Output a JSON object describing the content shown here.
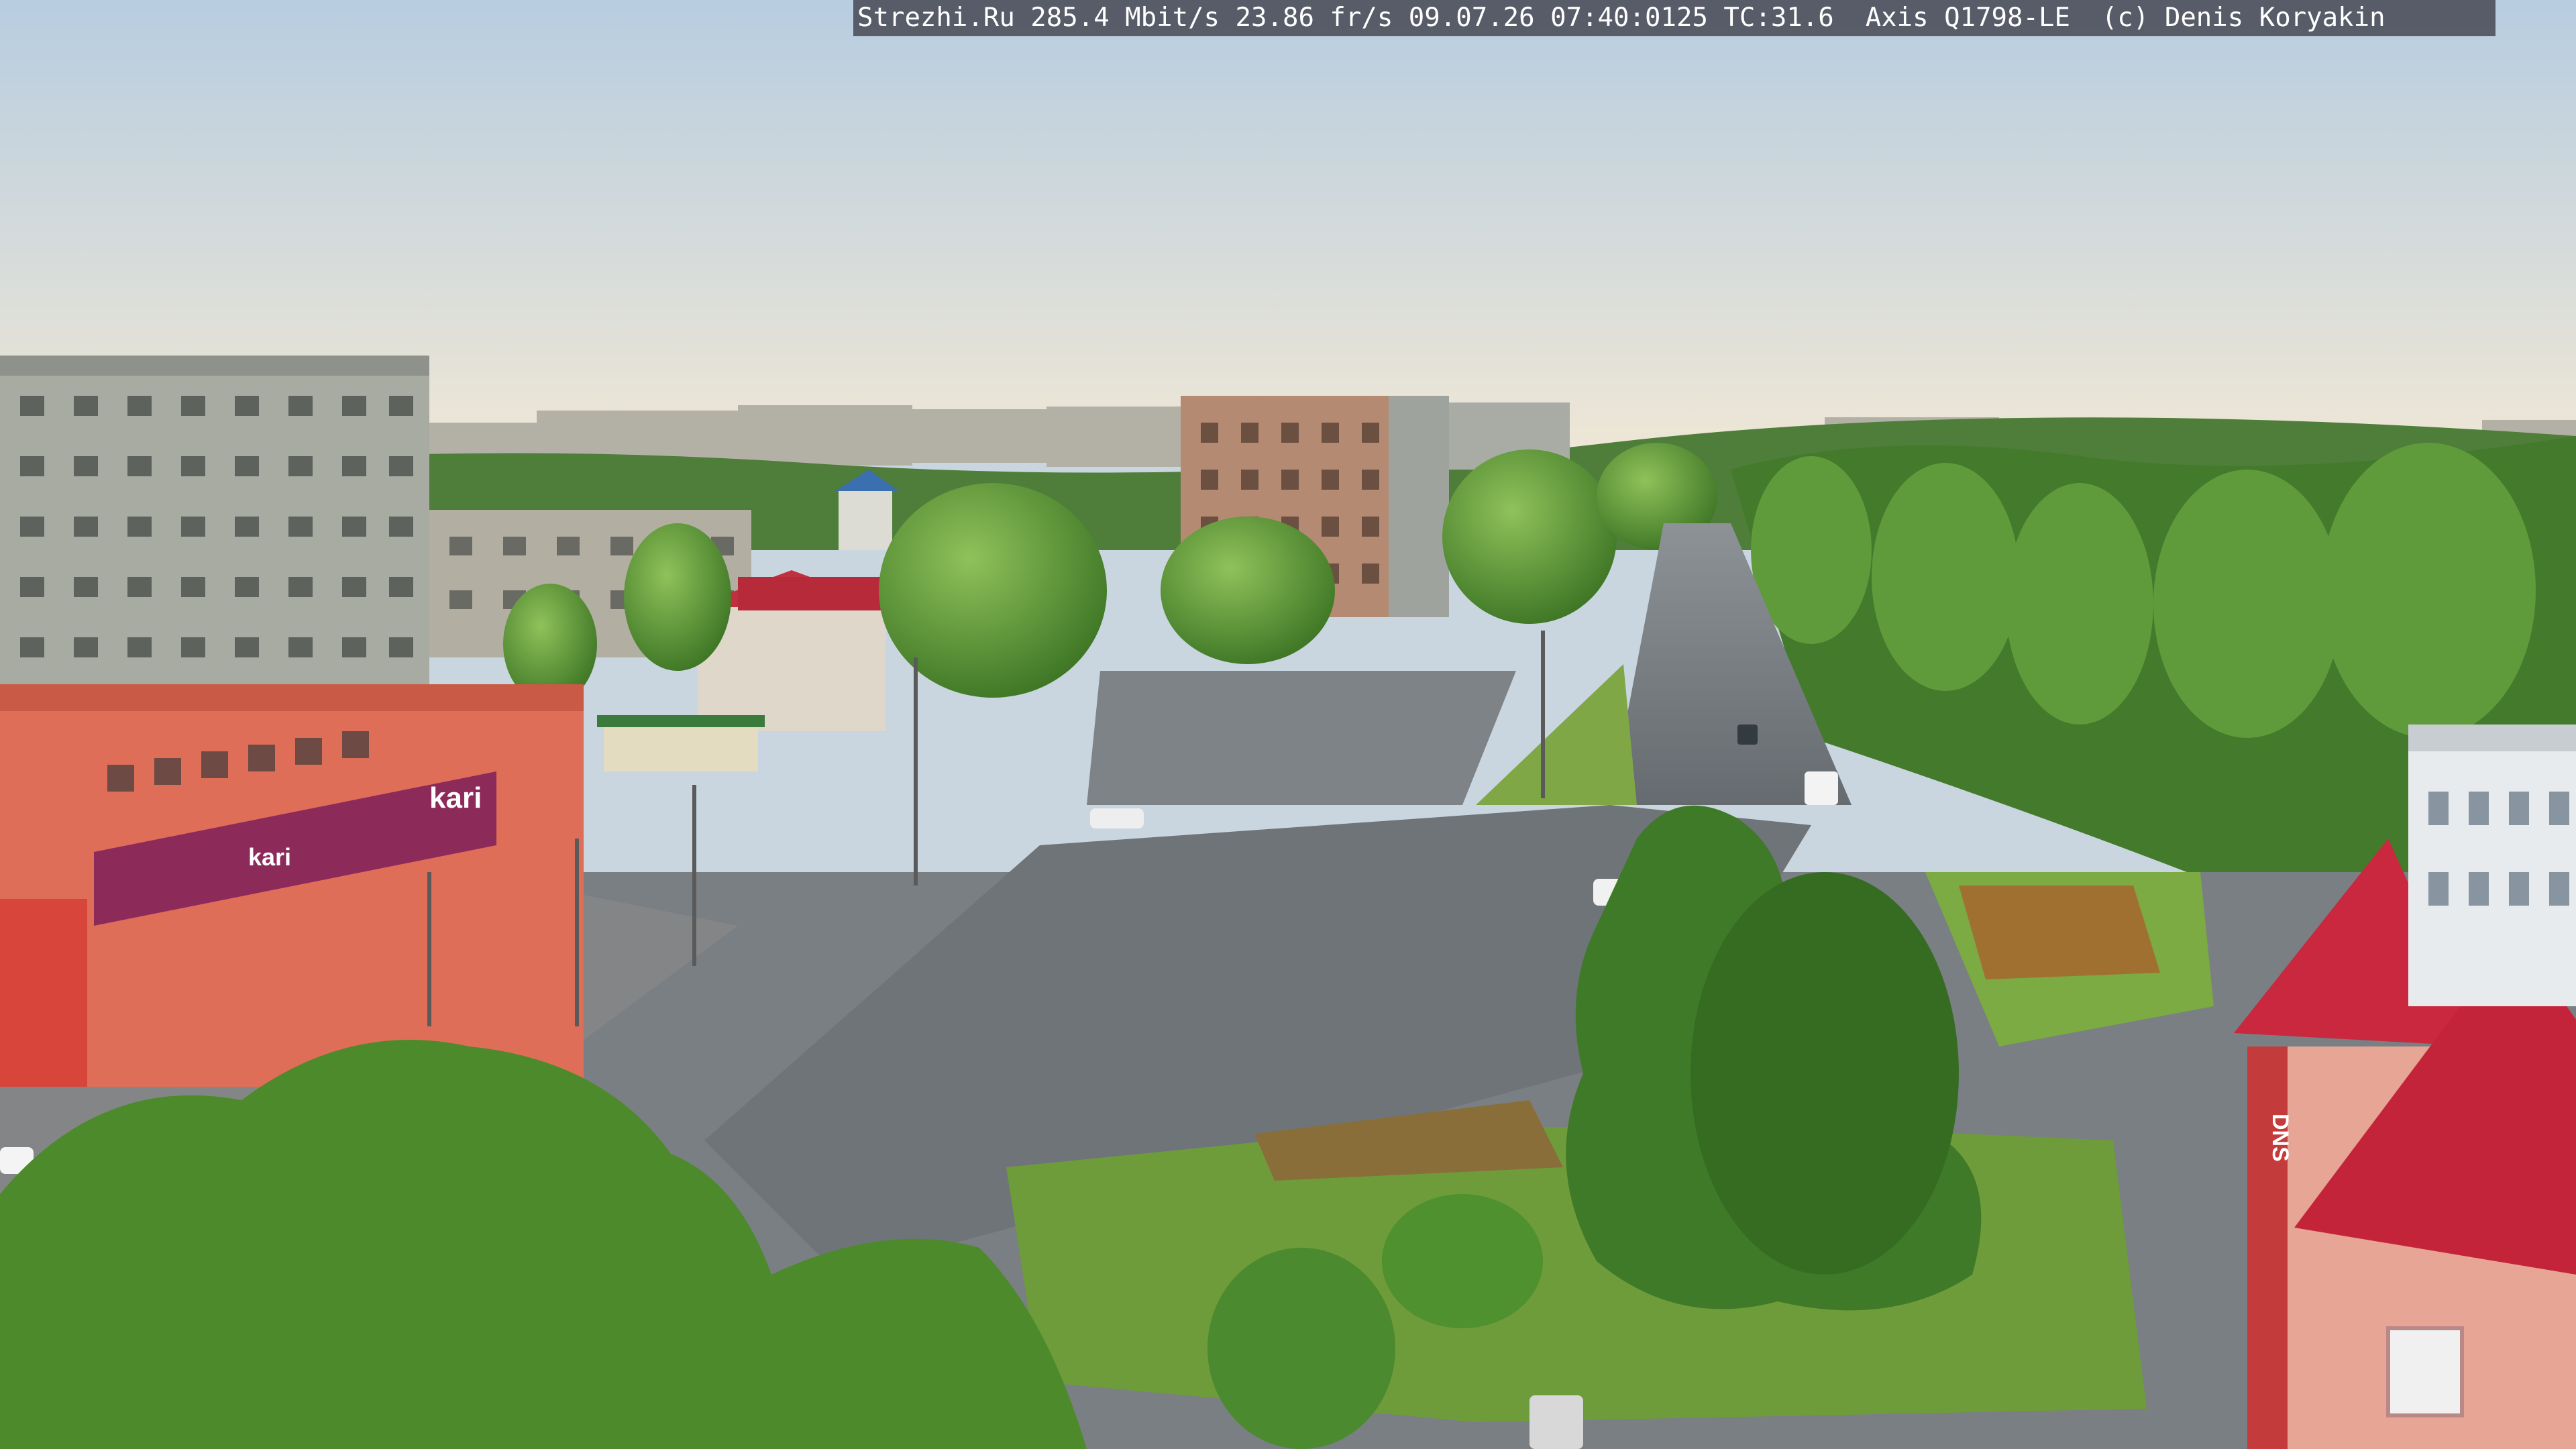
{
  "overlay": {
    "text": "Strezhi.Ru 285.4 Mbit/s 23.86 fr/s 09.07.26 07:40:0125 TC:31.6  Axis Q1798-LE  (c) Denis Koryakin"
  },
  "signs": {
    "store_brand": "kari",
    "store_brand_small": "kari",
    "tower_brand": "DNS"
  },
  "colors": {
    "sky_top": "#b9cfe0",
    "sky_bottom": "#ece6d8",
    "trees": "#4e8a2e",
    "trees_dark": "#2f6320",
    "road": "#6f7479",
    "road_light": "#8a8f93",
    "store_facade": "#e0705a",
    "store_sign": "#8c2a5a",
    "roof_red": "#b8283a",
    "tower_wall": "#e7a595",
    "grass": "#6ea23c",
    "apartment": "#a9aca3"
  }
}
